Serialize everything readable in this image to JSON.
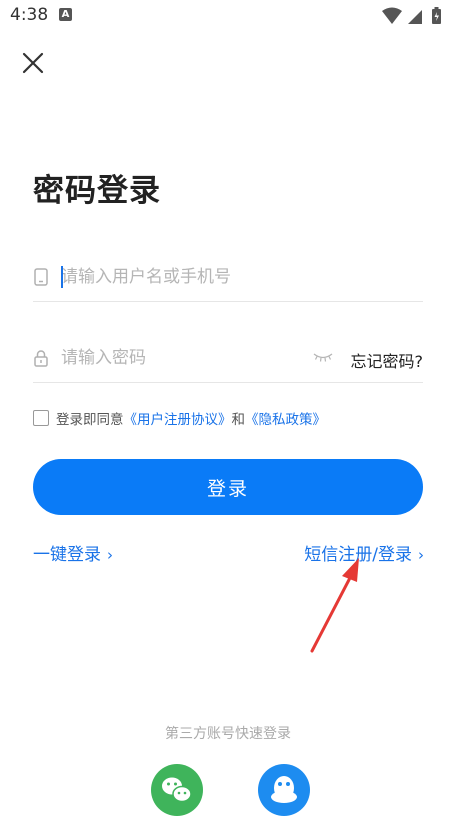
{
  "status_bar": {
    "time": "4:38",
    "notification_icon": "A"
  },
  "page": {
    "title": "密码登录"
  },
  "username": {
    "placeholder": "请输入用户名或手机号",
    "value": ""
  },
  "password": {
    "placeholder": "请输入密码",
    "value": "",
    "forgot_label": "忘记密码?"
  },
  "agreement": {
    "prefix": "登录即同意",
    "terms_link": "《用户注册协议》",
    "conjunction": "和",
    "privacy_link": "《隐私政策》"
  },
  "login_button": {
    "label": "登录"
  },
  "links": {
    "one_click": "一键登录",
    "sms": "短信注册/登录",
    "chevron": "›"
  },
  "third_party": {
    "label": "第三方账号快速登录"
  },
  "icons": {
    "close": "close-icon",
    "phone": "phone-icon",
    "lock": "lock-icon",
    "eye": "eye-closed-icon",
    "wechat": "wechat-icon",
    "qq": "qq-icon"
  },
  "colors": {
    "primary": "#0a7bf7",
    "link": "#1a73e8",
    "wechat": "#3fb45b",
    "qq": "#1d8cf0",
    "annotation_arrow": "#e53935"
  }
}
